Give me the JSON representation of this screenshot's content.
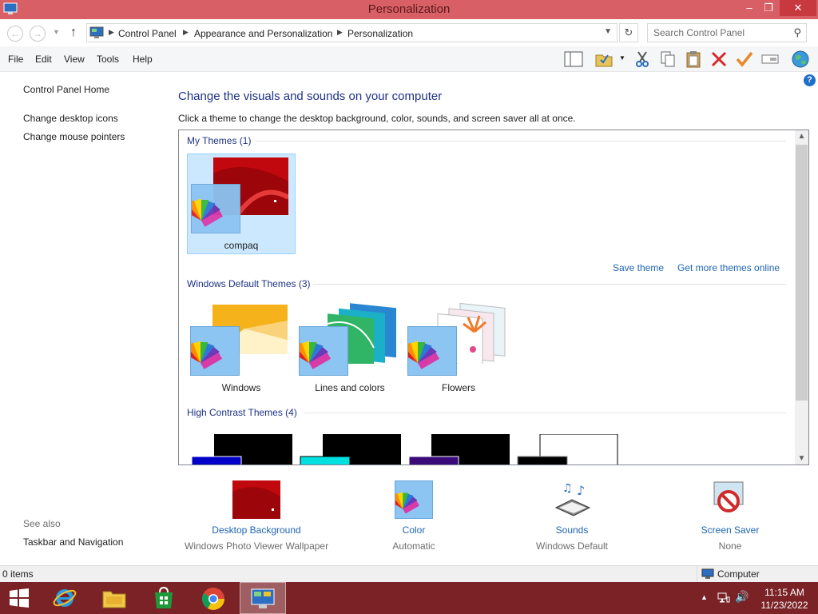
{
  "window": {
    "title": "Personalization",
    "minimize": "–",
    "maximize": "❐",
    "close": "✕"
  },
  "address": {
    "breadcrumbs": [
      "Control Panel",
      "Appearance and Personalization",
      "Personalization"
    ],
    "search_placeholder": "Search Control Panel"
  },
  "menu": [
    "File",
    "Edit",
    "View",
    "Tools",
    "Help"
  ],
  "toolbar_icons": [
    "layout-pane-icon",
    "checked-folder-icon",
    "cut-icon",
    "copy-icon",
    "paste-icon",
    "delete-icon",
    "check-icon",
    "rename-icon",
    "globe-icon"
  ],
  "left_pane": {
    "home": "Control Panel Home",
    "links": [
      "Change desktop icons",
      "Change mouse pointers"
    ],
    "see_also_label": "See also",
    "see_also_links": [
      "Taskbar and Navigation"
    ]
  },
  "main": {
    "heading": "Change the visuals and sounds on your computer",
    "subheading": "Click a theme to change the desktop background, color, sounds, and screen saver all at once.",
    "my_themes": {
      "title": "My Themes (1)",
      "themes": [
        {
          "name": "compaq",
          "selected": true
        }
      ]
    },
    "save_theme": "Save theme",
    "get_more": "Get more themes online",
    "default_themes": {
      "title": "Windows Default Themes (3)",
      "themes": [
        {
          "name": "Windows"
        },
        {
          "name": "Lines and colors"
        },
        {
          "name": "Flowers"
        }
      ]
    },
    "high_contrast": {
      "title": "High Contrast Themes (4)"
    }
  },
  "bottom": [
    {
      "title": "Desktop Background",
      "subtitle": "Windows Photo Viewer Wallpaper",
      "icon": "desktop-background-icon"
    },
    {
      "title": "Color",
      "subtitle": "Automatic",
      "icon": "color-fan-icon"
    },
    {
      "title": "Sounds",
      "subtitle": "Windows Default",
      "icon": "sounds-icon"
    },
    {
      "title": "Screen Saver",
      "subtitle": "None",
      "icon": "screen-saver-icon"
    }
  ],
  "status": {
    "items": "0 items",
    "zone": "Computer"
  },
  "taskbar": {
    "apps": [
      "start-icon",
      "internet-explorer-icon",
      "file-explorer-icon",
      "store-icon",
      "chrome-icon",
      "control-panel-icon"
    ],
    "time": "11:15 AM",
    "date": "11/23/2022"
  },
  "colors": {
    "titlebar": "#d85f65",
    "taskbar": "#7a2226",
    "link": "#1e64b4",
    "heading": "#1e3287"
  }
}
